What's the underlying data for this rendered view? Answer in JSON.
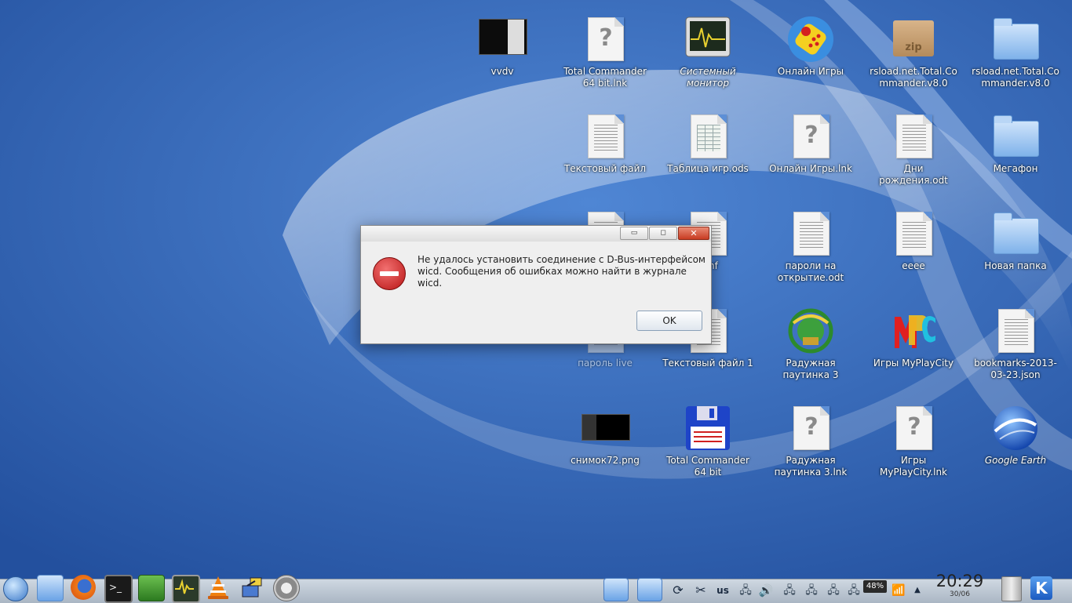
{
  "colors": {
    "desktop": "#2f64b8",
    "dialog_bg": "#efefef",
    "taskbar": "#c2ccd8"
  },
  "desktop_icons": [
    {
      "label": "vvdv",
      "kind": "screenshot"
    },
    {
      "label": "Total Commander 64 bit.lnk",
      "kind": "unknown-file"
    },
    {
      "label": "Системный монитор",
      "kind": "system-monitor",
      "italic": true
    },
    {
      "label": "Онлайн Игры",
      "kind": "games-app"
    },
    {
      "label": "rsload.net.Total.Commander.v8.0",
      "kind": "zip-archive"
    },
    {
      "label": "rsload.net.Total.Commander.v8.0",
      "kind": "folder"
    },
    {
      "label": "Текстовый файл",
      "kind": "text-file"
    },
    {
      "label": "Таблица игр.ods",
      "kind": "spreadsheet"
    },
    {
      "label": "Онлайн Игры.lnk",
      "kind": "unknown-file"
    },
    {
      "label": "Дни рождения.odt",
      "kind": "document"
    },
    {
      "label": "Мегафон",
      "kind": "folder"
    },
    {
      "label": "conf",
      "kind": "text-file"
    },
    {
      "label": "пароли на открытие.odt",
      "kind": "document"
    },
    {
      "label": "eeee",
      "kind": "text-file"
    },
    {
      "label": "Новая папка",
      "kind": "folder"
    },
    {
      "label": "пароль live",
      "kind": "text-file"
    },
    {
      "label": "Текстовый файл 1",
      "kind": "text-file"
    },
    {
      "label": "Радужная паутинка 3",
      "kind": "game-logo"
    },
    {
      "label": "Игры MyPlayCity",
      "kind": "mpc-logo"
    },
    {
      "label": "bookmarks-2013-03-23.json",
      "kind": "text-file"
    },
    {
      "label": "снимок72.png",
      "kind": "screenshot"
    },
    {
      "label": "Total Commander 64 bit",
      "kind": "floppy-app"
    },
    {
      "label": "Радужная паутинка 3.lnk",
      "kind": "unknown-file"
    },
    {
      "label": "Игры MyPlayCity.lnk",
      "kind": "unknown-file"
    },
    {
      "label": "Google Earth",
      "kind": "globe-app",
      "italic": true
    }
  ],
  "dialog": {
    "minimize_symbol": "▭",
    "maximize_symbol": "◻",
    "close_symbol": "✕",
    "message": "Не удалось установить соединение с D-Bus-интерфейсом wicd. Сообщения об ошибках можно найти в журнале wicd.",
    "ok_label": "OK",
    "icon": "error-icon"
  },
  "taskbar": {
    "launchers": [
      "application-menu-icon",
      "file-manager-icon",
      "firefox-icon",
      "terminal-icon",
      "video-editor-icon",
      "system-monitor-icon",
      "vlc-icon",
      "network-manager-icon",
      "settings-icon"
    ],
    "tray": {
      "keyboard_layout": "us",
      "battery": "48%",
      "time": "20:29",
      "date": "30/06"
    }
  }
}
